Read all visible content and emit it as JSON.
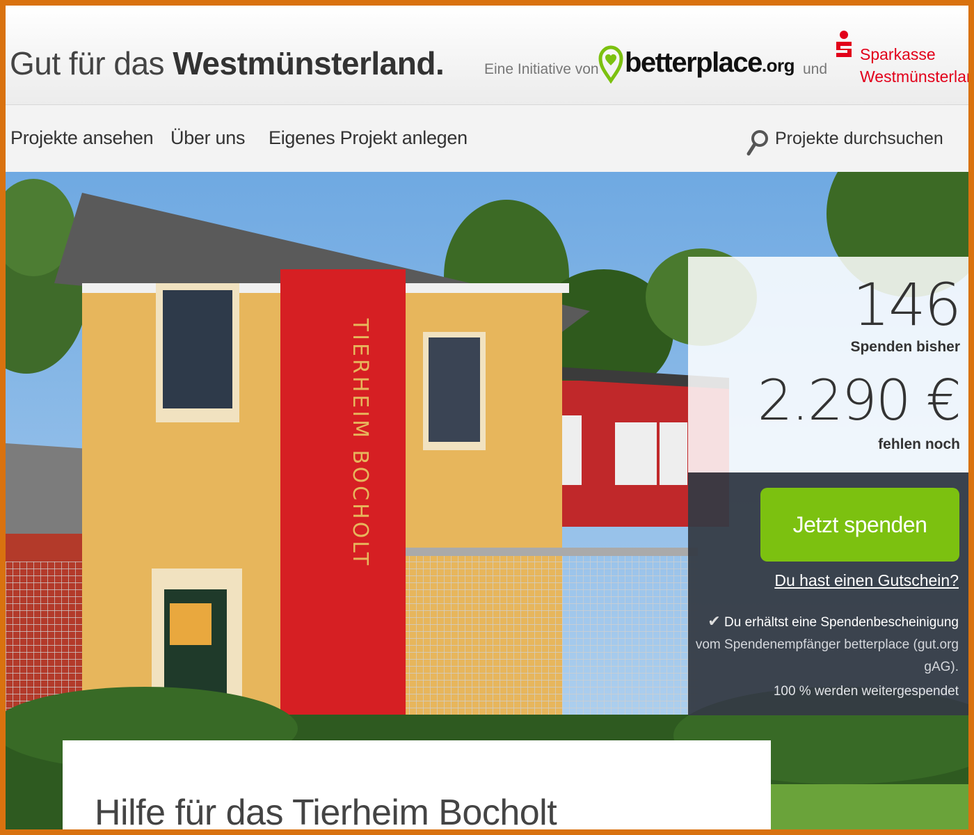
{
  "header": {
    "title_prefix": "Gut für das ",
    "title_bold": "Westmünsterland.",
    "initiative_label": "Eine Initiative von",
    "betterplace_logo_text": "betterplace",
    "betterplace_logo_tld": ".org",
    "und_label": "und",
    "sparkasse_line1": "Sparkasse",
    "sparkasse_line2": "Westmünsterlan"
  },
  "nav": {
    "items": [
      {
        "label": "Projekte ansehen"
      },
      {
        "label": "Über uns"
      },
      {
        "label": "Eigenes Projekt anlegen"
      }
    ],
    "search_label": "Projekte durchsuchen",
    "search_icon": "search-icon"
  },
  "hero": {
    "building_sign": "TIERHEIM BOCHOLT"
  },
  "stats": {
    "donations_count": "146",
    "donations_label": "Spenden bisher",
    "missing_amount": "2.290 €",
    "missing_label": "fehlen noch"
  },
  "donate": {
    "button_label": "Jetzt spenden",
    "voucher_link": "Du hast einen Gutschein?",
    "receipt_line1": "Du erhältst eine Spendenbescheinigung",
    "receipt_line2": "vom Spendenempfänger betterplace (gut.org gAG).",
    "forward_note": "100 % werden weitergespendet",
    "check_icon": "check-icon"
  },
  "project": {
    "title": "Hilfe für das Tierheim Bocholt"
  },
  "colors": {
    "accent_green": "#7cc110",
    "sparkasse_red": "#e2001a",
    "frame_orange": "#d9720f",
    "panel_dark": "#343a44"
  }
}
